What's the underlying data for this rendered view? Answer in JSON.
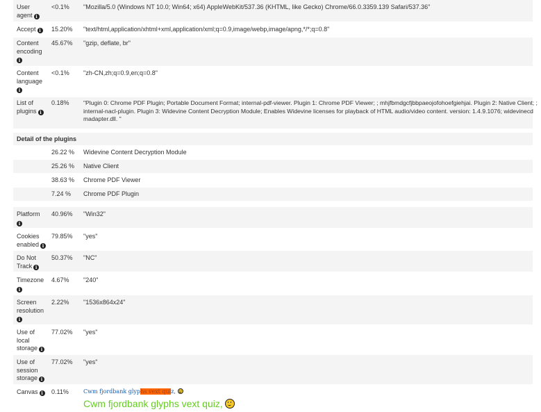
{
  "rows": {
    "user_agent": {
      "label_1": "User",
      "label_2": "agent",
      "percent": "<0.1%",
      "value": "\"Mozilla/5.0 (Windows NT 10.0; Win64; x64) AppleWebKit/537.36 (KHTML, like Gecko) Chrome/66.0.3359.139 Safari/537.36\""
    },
    "accept": {
      "label": "Accept",
      "percent": "15.20%",
      "value": "\"text/html,application/xhtml+xml,application/xml;q=0.9,image/webp,image/apng,*/*;q=0.8\""
    },
    "content_encoding": {
      "label_1": "Content",
      "label_2": "encoding",
      "percent": "45.67%",
      "value": "\"gzip, deflate, br\""
    },
    "content_language": {
      "label_1": "Content",
      "label_2": "language",
      "percent": "<0.1%",
      "value": "\"zh-CN,zh;q=0.9,en;q=0.8\""
    },
    "list_of_plugins": {
      "label_1": "List of",
      "label_2": "plugins",
      "percent": "0.18%",
      "value_lines": [
        "\"Plugin 0: Chrome PDF Plugin; Portable Document Format; internal-pdf-viewer. Plugin 1: Chrome PDF Viewer; ; mhjfbmdgcfjbbpaeojofohoefgiehjai. Plugin 2: Native Client; ;",
        "internal-nacl-plugin. Plugin 3: Widevine Content Decryption Module; Enables Widevine licenses for playback of HTML audio/video content. version: 1.4.9.1076; widevinecd",
        "madapter.dll. \""
      ]
    },
    "platform": {
      "label": "Platform",
      "percent": "40.96%",
      "value": "\"Win32\""
    },
    "cookies": {
      "label_1": "Cookies",
      "label_2": "enabled",
      "percent": "79.85%",
      "value": "\"yes\""
    },
    "do_not_track": {
      "label_1": "Do Not",
      "label_2": "Track",
      "percent": "50.37%",
      "value": "\"NC\""
    },
    "timezone": {
      "label": "Timezone",
      "percent": "4.67%",
      "value": "\"240\""
    },
    "screen_resolution": {
      "label_1": "Screen",
      "label_2": "resolution",
      "percent": "2.22%",
      "value": "\"1536x864x24\""
    },
    "local_storage": {
      "label_1": "Use of",
      "label_2": "local",
      "label_3": "storage",
      "percent": "77.02%",
      "value": "\"yes\""
    },
    "session_storage": {
      "label_1": "Use of",
      "label_2": "session",
      "label_3": "storage",
      "percent": "77.02%",
      "value": "\"yes\""
    },
    "canvas": {
      "label": "Canvas",
      "percent": "0.11%",
      "small_text_a": "Cwm fjordbank glyp",
      "small_text_hl": "hs vext qui",
      "small_text_b": "z,",
      "big_text": "Cwm fjordbank glyphs vext quiz,"
    }
  },
  "plugins_detail": {
    "heading": "Detail of the plugins",
    "items": [
      {
        "percent": "26.22 %",
        "name": "Widevine Content Decryption Module"
      },
      {
        "percent": "25.26 %",
        "name": "Native Client"
      },
      {
        "percent": "38.63 %",
        "name": "Chrome PDF Viewer"
      },
      {
        "percent": "7.24 %",
        "name": "Chrome PDF Plugin"
      }
    ]
  },
  "icons": {
    "info": "info-circle-icon",
    "emoji": "smiley-face-icon"
  },
  "colors": {
    "row_shade": "#f4f4f4",
    "canvas_small": "#1a5ca8",
    "canvas_highlight": "#ff6600",
    "canvas_big": "#66cc22"
  }
}
